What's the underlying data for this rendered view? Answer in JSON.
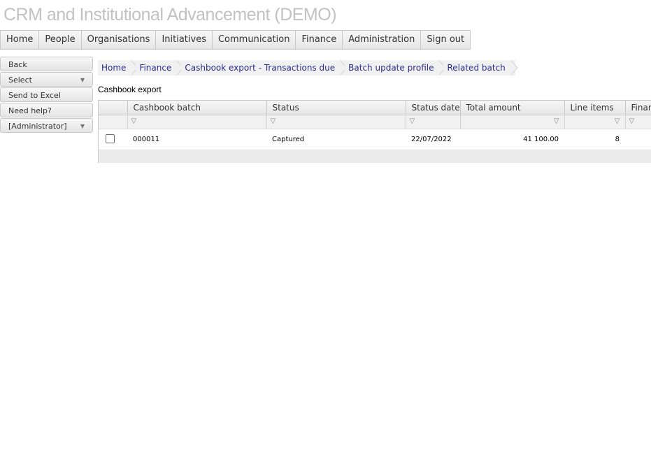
{
  "app": {
    "title": "CRM and Institutional Advancement (DEMO)"
  },
  "topnav": [
    "Home",
    "People",
    "Organisations",
    "Initiatives",
    "Communication",
    "Finance",
    "Administration",
    "Sign out"
  ],
  "side": {
    "back": "Back",
    "select": "Select",
    "excel": "Send to Excel",
    "help": "Need help?",
    "role": "[Administrator]"
  },
  "breadcrumb": [
    "Home",
    "Finance",
    "Cashbook export - Transactions due",
    "Batch update profile",
    "Related batch"
  ],
  "section": {
    "title": "Cashbook export"
  },
  "grid": {
    "columns": [
      "Cashbook batch",
      "Status",
      "Status date",
      "Total amount",
      "Line items",
      "Finan"
    ],
    "rows": [
      {
        "batch": "000011",
        "status": "Captured",
        "date": "22/07/2022",
        "amount": "41 100.00",
        "items": "8",
        "finan": ""
      }
    ]
  }
}
